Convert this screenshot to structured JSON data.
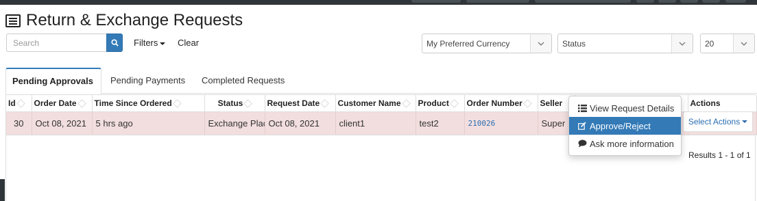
{
  "page": {
    "title": "Return & Exchange Requests"
  },
  "toolbar": {
    "search_placeholder": "Search",
    "filters_label": "Filters",
    "clear_label": "Clear",
    "currency_select": "My Preferred Currency",
    "status_select": "Status",
    "page_size_select": "20"
  },
  "tabs": [
    {
      "label": "Pending Approvals",
      "active": true
    },
    {
      "label": "Pending Payments",
      "active": false
    },
    {
      "label": "Completed Requests",
      "active": false
    }
  ],
  "table": {
    "columns": [
      "Id",
      "Order Date",
      "Time Since Ordered",
      "Status",
      "Request Date",
      "Customer Name",
      "Product",
      "Order Number",
      "Seller",
      "",
      "Actions"
    ],
    "rows": [
      {
        "id": "30",
        "order_date": "Oct 08, 2021",
        "time_since": "5 hrs ago",
        "status": "Exchange Placed",
        "request_date": "Oct 08, 2021",
        "customer": "client1",
        "product": "test2",
        "order_number": "210026",
        "seller": "Super"
      }
    ],
    "row_highlight_color": "#f2dede"
  },
  "actions": {
    "select_label": "Select Actions",
    "menu": [
      {
        "label": "View Request Details",
        "icon": "list-icon"
      },
      {
        "label": "Approve/Reject",
        "icon": "edit-icon",
        "active": true
      },
      {
        "label": "Ask more information",
        "icon": "comment-icon"
      }
    ]
  },
  "footer": {
    "results": "Results 1 - 1 of 1"
  },
  "colors": {
    "primary": "#337ab7",
    "link": "#2a6db0",
    "topbar": "#2f3539"
  }
}
